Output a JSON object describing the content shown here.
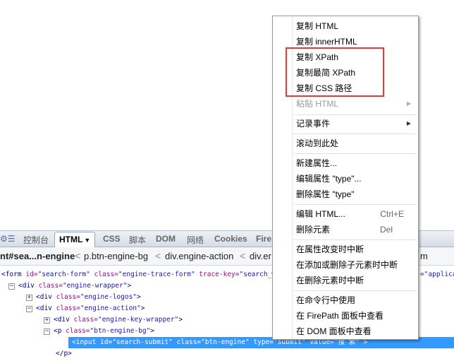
{
  "tabs": {
    "fb_icon": "⚙☰",
    "console": "控制台",
    "html": "HTML",
    "html_caret": "▼",
    "css": "CSS",
    "script": "脚本",
    "dom": "DOM",
    "net": "网络",
    "cookies": "Cookies",
    "fire": "Fire"
  },
  "breadcrumb": {
    "current": "nt#sea...n-engine",
    "sep": "<",
    "items": [
      "p.btn-engine-bg",
      "div.engine-action",
      "div.er",
      "m"
    ]
  },
  "tree": {
    "line1": {
      "tag_open": "<form ",
      "a1": "id=",
      "v1": "\"search-form\"",
      "a2": " class=",
      "v2": "\"engine-trace-form\"",
      "a3": " trace-key=",
      "v3": "\"search_web",
      "tail": "=\"applica"
    },
    "line2": {
      "tag": "<div ",
      "a1": "class=",
      "v1": "\"engine-wrapper\"",
      "end": ">"
    },
    "line3": {
      "tag": "<div ",
      "a1": "class=",
      "v1": "\"engine-logos\"",
      "end": ">"
    },
    "line4": {
      "tag": "<div ",
      "a1": "class=",
      "v1": "\"engine-action\"",
      "end": ">"
    },
    "line5": {
      "tag": "<div ",
      "a1": "class=",
      "v1": "\"engine-key-wrapper\"",
      "end": ">"
    },
    "line6": {
      "tag": "<p ",
      "a1": "class=",
      "v1": "\"btn-engine-bg\"",
      "end": ">"
    },
    "line7": "<input id=\"search-submit\" class=\"btn-engine\" type=\"submit\" value=\"搜 索\" >",
    "line8": "</p>",
    "toggle_minus": "−",
    "toggle_plus": "+"
  },
  "menu": {
    "items": [
      {
        "label": "复制 HTML"
      },
      {
        "label": "复制 innerHTML"
      },
      {
        "label": "复制 XPath"
      },
      {
        "label": "复制最简 XPath"
      },
      {
        "label": "复制 CSS 路径"
      },
      {
        "label": "粘贴 HTML",
        "disabled": true,
        "submenu": true
      },
      {
        "label": "记录事件",
        "submenu": true
      },
      {
        "label": "滚动到此处"
      },
      {
        "label": "新建属性..."
      },
      {
        "label": "编辑属性 \"type\"..."
      },
      {
        "label": "删除属性 \"type\""
      },
      {
        "label": "编辑 HTML...",
        "shortcut": "Ctrl+E"
      },
      {
        "label": "删除元素",
        "shortcut": "Del"
      },
      {
        "label": "在属性改变时中断"
      },
      {
        "label": "在添加或删除子元素时中断"
      },
      {
        "label": "在删除元素时中断"
      },
      {
        "label": "在命令行中使用"
      },
      {
        "label": "在 FirePath 面板中查看"
      },
      {
        "label": "在 DOM 面板中查看"
      }
    ],
    "arrow": "▶"
  },
  "colors": {
    "highlight_border": "#e03a3a",
    "selection": "#3399ff"
  }
}
